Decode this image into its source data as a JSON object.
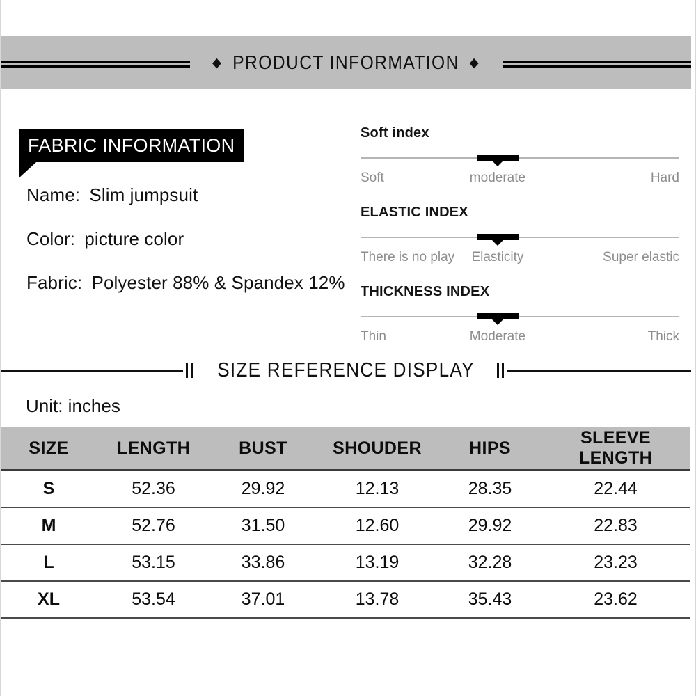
{
  "banner": {
    "title": "PRODUCT INFORMATION",
    "diamond_icon": "diamond-glyph",
    "left_diamond": "◆",
    "right_diamond": "◆",
    "background_color": "#bdbdbd"
  },
  "fabric": {
    "tag_label": "FABRIC INFORMATION",
    "rows": [
      {
        "label": "Name:",
        "value": "Slim jumpsuit"
      },
      {
        "label": "Color:",
        "value": "picture color"
      },
      {
        "label": "Fabric:",
        "value": "Polyester 88% & Spandex 12%"
      }
    ]
  },
  "indices": [
    {
      "title": "Soft index",
      "left": "Soft",
      "mid": "moderate",
      "right": "Hard",
      "marker_percent": 43
    },
    {
      "title": "ELASTIC INDEX",
      "left": "There is no play",
      "mid": "Elasticity",
      "right": "Super elastic",
      "marker_percent": 43
    },
    {
      "title": "THICKNESS INDEX",
      "left": "Thin",
      "mid": "Moderate",
      "right": "Thick",
      "marker_percent": 43
    }
  ],
  "size_section": {
    "divider_title": "SIZE REFERENCE DISPLAY",
    "unit_label": "Unit: inches"
  },
  "size_table": {
    "headers": [
      "SIZE",
      "LENGTH",
      "BUST",
      "SHOUDER",
      "HIPS",
      "SLEEVE LENGTH"
    ],
    "rows": [
      {
        "size": "S",
        "length": "52.36",
        "bust": "29.92",
        "shoulder": "12.13",
        "hips": "28.35",
        "sleeve": "22.44"
      },
      {
        "size": "M",
        "length": "52.76",
        "bust": "31.50",
        "shoulder": "12.60",
        "hips": "29.92",
        "sleeve": "22.83"
      },
      {
        "size": "L",
        "length": "53.15",
        "bust": "33.86",
        "shoulder": "13.19",
        "hips": "32.28",
        "sleeve": "23.23"
      },
      {
        "size": "XL",
        "length": "53.54",
        "bust": "37.01",
        "shoulder": "13.78",
        "hips": "35.43",
        "sleeve": "23.62"
      }
    ]
  },
  "colors": {
    "band_gray": "#bdbdbd",
    "rule_black": "#000000",
    "muted_text": "#8d8d8d"
  }
}
